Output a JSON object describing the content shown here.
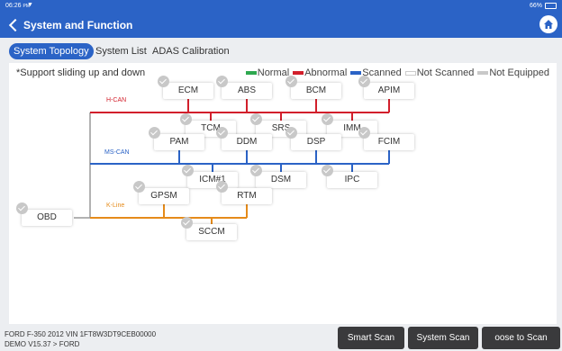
{
  "status_bar": {
    "time": "06:26",
    "time_suffix": "PM",
    "battery": "66%"
  },
  "header": {
    "title": "System and Function"
  },
  "tabs": [
    {
      "label": "System Topology",
      "active": true
    },
    {
      "label": "System List",
      "active": false
    },
    {
      "label": "ADAS Calibration",
      "active": false
    }
  ],
  "topology": {
    "hint": "*Support sliding up and down",
    "legend": [
      {
        "label": "Normal",
        "color": "#2ea84f"
      },
      {
        "label": "Abnormal",
        "color": "#d21f2b"
      },
      {
        "label": "Scanned",
        "color": "#2b63c6"
      },
      {
        "label": "Not Scanned",
        "color": ""
      },
      {
        "label": "Not Equipped",
        "color": "#c8c8c8"
      }
    ],
    "buses": [
      {
        "label": "H-CAN",
        "color": "#d21f2b"
      },
      {
        "label": "MS-CAN",
        "color": "#2b63c6"
      },
      {
        "label": "K-Line",
        "color": "#e58b1a"
      }
    ],
    "gateway": "OBD",
    "modules": {
      "hcan_top": [
        "ECM",
        "ABS",
        "BCM",
        "APIM"
      ],
      "hcan_bottom": [
        "TCM",
        "SRS",
        "IMM"
      ],
      "mscan_top": [
        "PAM",
        "DDM",
        "DSP",
        "FCIM"
      ],
      "mscan_bottom": [
        "ICM#1",
        "DSM",
        "IPC"
      ],
      "kline_top": [
        "GPSM",
        "RTM"
      ],
      "kline_bottom": [
        "SCCM"
      ]
    }
  },
  "footer": {
    "vehicle": "FORD  F-350  2012  VIN  1FT8W3DT9CEB00000",
    "version_prefix": "DEMO V15.37 > ",
    "version_make": "FORD",
    "buttons": [
      "Smart Scan",
      "System Scan",
      "oose to Scan"
    ]
  }
}
